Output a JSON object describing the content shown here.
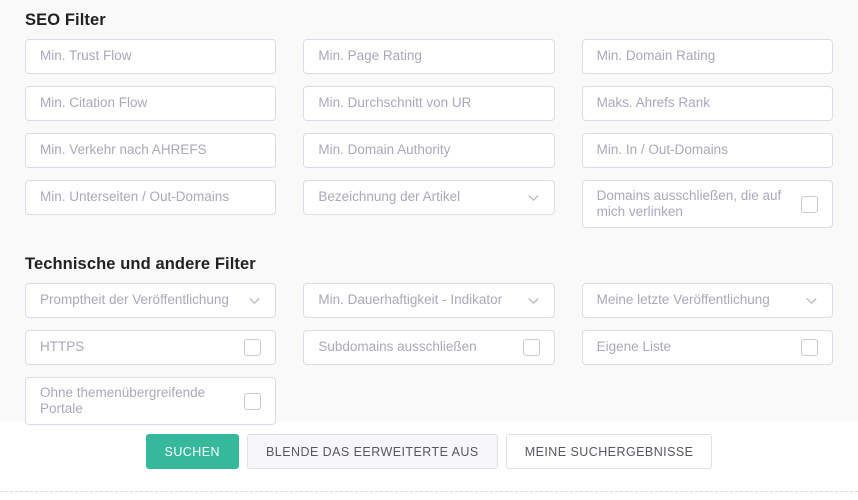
{
  "colors": {
    "accent": "#36b99b",
    "panel_bg": "#f9f9fa",
    "field_border": "#dcdce6",
    "placeholder": "#a9a9bb",
    "heading": "#222222"
  },
  "seo_section": {
    "title": "SEO Filter",
    "fields": [
      {
        "name": "min-trust-flow",
        "type": "text",
        "placeholder": "Min. Trust Flow"
      },
      {
        "name": "min-page-rating",
        "type": "text",
        "placeholder": "Min. Page Rating"
      },
      {
        "name": "min-domain-rating",
        "type": "text",
        "placeholder": "Min. Domain Rating"
      },
      {
        "name": "min-citation-flow",
        "type": "text",
        "placeholder": "Min. Citation Flow"
      },
      {
        "name": "min-durchschnitt-von-ur",
        "type": "text",
        "placeholder": "Min. Durchschnitt von UR"
      },
      {
        "name": "maks-ahrefs-rank",
        "type": "text",
        "placeholder": "Maks. Ahrefs Rank"
      },
      {
        "name": "min-verkehr-nach-ahrefs",
        "type": "text",
        "placeholder": "Min. Verkehr nach AHREFS"
      },
      {
        "name": "min-domain-authority",
        "type": "text",
        "placeholder": "Min. Domain Authority"
      },
      {
        "name": "min-in-out-domains",
        "type": "text",
        "placeholder": "Min. In / Out-Domains"
      },
      {
        "name": "min-unterseiten-out-domains",
        "type": "text",
        "placeholder": "Min. Unterseiten / Out-Domains"
      },
      {
        "name": "bezeichnung-der-artikel",
        "type": "select",
        "placeholder": "Bezeichnung der Artikel"
      },
      {
        "name": "domains-ausschliessen-die-auf-mich-verlinken",
        "type": "checkbox",
        "tall": true,
        "placeholder": "Domains ausschließen, die auf mich verlinken"
      }
    ]
  },
  "technical_section": {
    "title": "Technische und andere Filter",
    "fields": [
      {
        "name": "promptheit-der-veroeffentlichung",
        "type": "select",
        "placeholder": "Promptheit der Veröffentlichung"
      },
      {
        "name": "min-dauerhaftigkeit-indikator",
        "type": "select",
        "placeholder": "Min. Dauerhaftigkeit - Indikator"
      },
      {
        "name": "meine-letzte-veroeffentlichung",
        "type": "select",
        "placeholder": "Meine letzte Veröffentlichung"
      },
      {
        "name": "https",
        "type": "checkbox",
        "placeholder": "HTTPS"
      },
      {
        "name": "subdomains-ausschliessen",
        "type": "checkbox",
        "placeholder": "Subdomains ausschließen"
      },
      {
        "name": "eigene-liste",
        "type": "checkbox",
        "placeholder": "Eigene Liste"
      },
      {
        "name": "ohne-themenuebergreifende-portale",
        "type": "checkbox",
        "tall": true,
        "placeholder": "Ohne themenübergreifende Portale"
      }
    ]
  },
  "actions": {
    "search_label": "SUCHEN",
    "collapse_label": "BLENDE DAS EERWEITERTE AUS",
    "results_label": "MEINE SUCHERGEBNISSE"
  }
}
